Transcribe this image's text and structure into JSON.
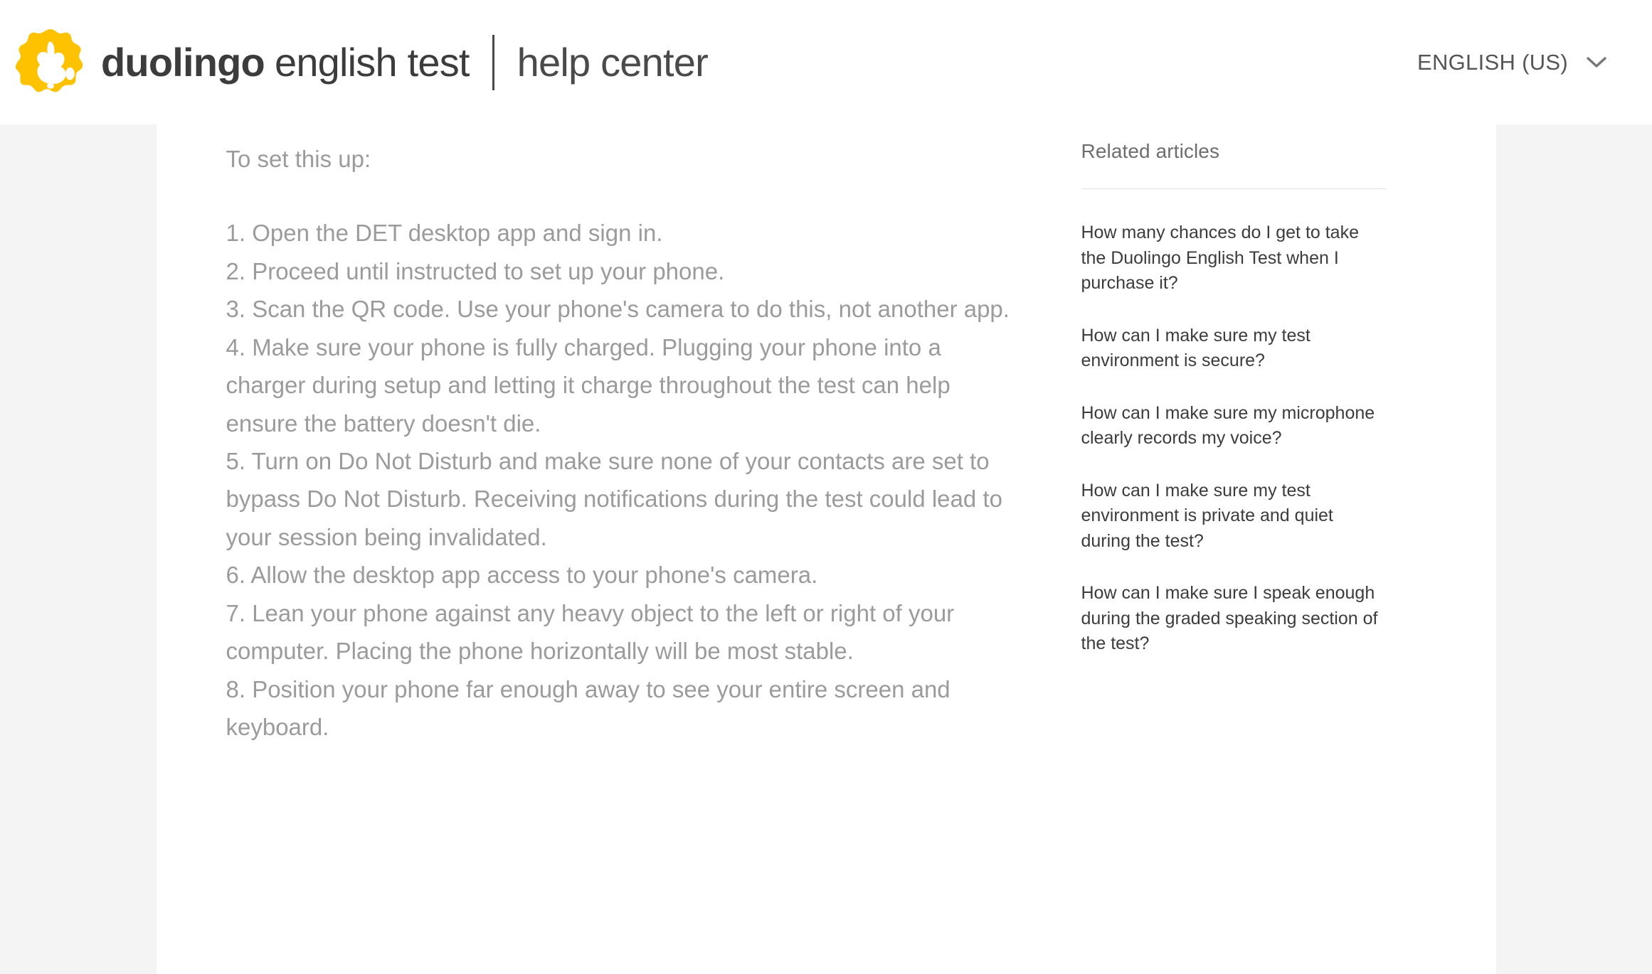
{
  "header": {
    "logo_icon": "duolingo-owl-icon",
    "brand_bold": "duolingo",
    "brand_regular": "english test",
    "section_title": "help center",
    "language_label": "ENGLISH (US)",
    "chevron_icon": "chevron-down-icon",
    "colors": {
      "owl_body": "#FFC200",
      "owl_face": "#FFFFFF",
      "brand_text": "#3C3C3C",
      "language_text": "#555555",
      "header_bg": "#FFFFFF"
    }
  },
  "main": {
    "intro": "To set this up:",
    "steps": [
      "1. Open the DET desktop app and sign in.",
      "2. Proceed until instructed to set up your phone.",
      "3. Scan the QR code. Use your phone's camera to do this, not another app.",
      "4. Make sure your phone is fully charged. Plugging your phone into a charger during setup and letting it charge throughout the test can help ensure the battery doesn't die.",
      "5. Turn on Do Not Disturb and make sure none of your contacts are set to bypass Do Not Disturb. Receiving notifications during the test could lead to your session being invalidated.",
      "6. Allow the desktop app access to your phone's camera.",
      "7. Lean your phone against any heavy object to the left or right of your computer. Placing the phone horizontally will be most stable.",
      "8. Position your phone far enough away to see your entire screen and keyboard."
    ],
    "body_text_color": "#9B9B9B"
  },
  "sidebar": {
    "heading": "Related articles",
    "articles": [
      "How many chances do I get to take the Duolingo English Test when I purchase it?",
      "How can I make sure my test environment is secure?",
      "How can I make sure my microphone clearly records my voice?",
      "How can I make sure my test environment is private and quiet during the test?",
      "How can I make sure I speak enough during the graded speaking section of the test?"
    ],
    "link_color": "#3C3C3C"
  },
  "page": {
    "background_color": "#F4F4F4",
    "card_background": "#FFFFFF"
  }
}
